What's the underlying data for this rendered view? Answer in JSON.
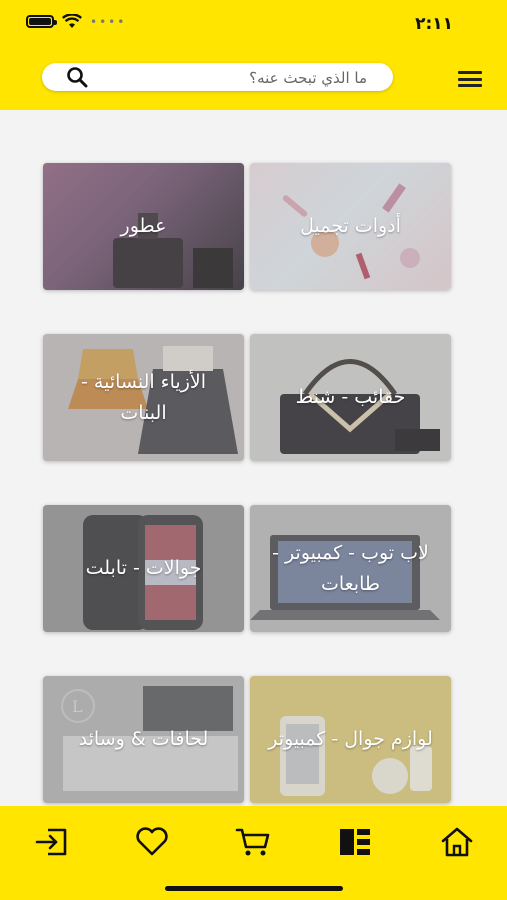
{
  "status": {
    "time": "٢:١١"
  },
  "search": {
    "placeholder": "ما الذي تبحث عنه؟"
  },
  "categories": [
    {
      "label": "أدوات تجميل"
    },
    {
      "label": "عطور"
    },
    {
      "label": "حقائب - شنط"
    },
    {
      "label": "الأزياء النسائية - البنات"
    },
    {
      "label": "لاب توب - كمبيوتر - طابعات"
    },
    {
      "label": "جوالات - تابلت"
    },
    {
      "label": "لوازم جوال - كمبيوتر"
    },
    {
      "label": "لحافات & وسائد"
    }
  ],
  "nav": {
    "items": [
      "home-icon",
      "categories-icon",
      "cart-icon",
      "heart-icon",
      "login-icon"
    ],
    "active": "categories-icon"
  },
  "colors": {
    "brand": "#ffe500"
  }
}
